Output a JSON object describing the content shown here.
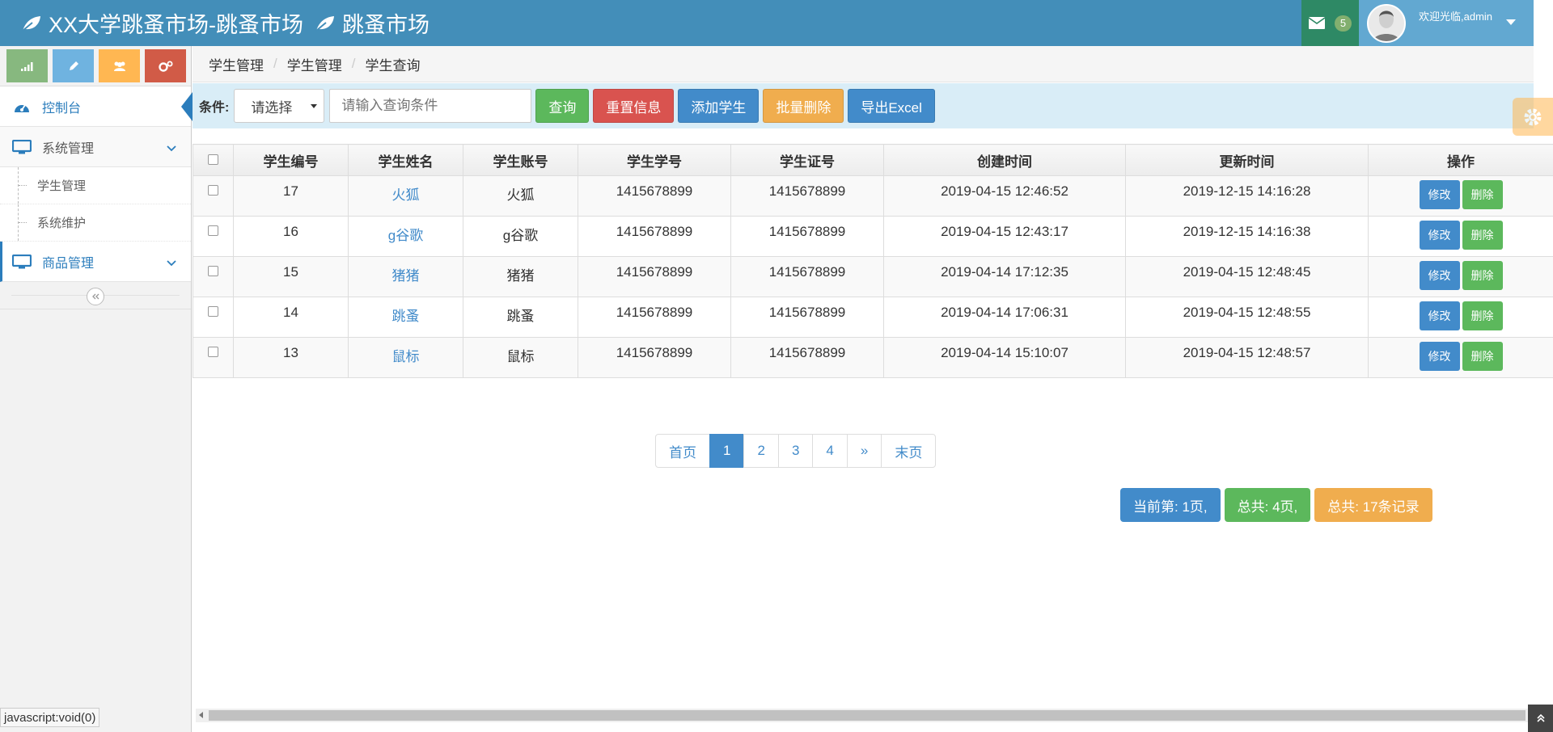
{
  "navbar": {
    "brand_primary": "XX大学跳蚤市场-跳蚤市场",
    "brand_secondary": "跳蚤市场",
    "mail_count": "5",
    "welcome": "欢迎光临,admin"
  },
  "sidebar": {
    "items": [
      {
        "label": "控制台"
      },
      {
        "label": "系统管理"
      },
      {
        "label": "商品管理"
      }
    ],
    "sub_items": [
      {
        "label": "学生管理"
      },
      {
        "label": "系统维护"
      }
    ]
  },
  "breadcrumb": {
    "items": [
      {
        "label": "学生管理"
      },
      {
        "label": "学生管理"
      },
      {
        "label": "学生查询"
      }
    ]
  },
  "search": {
    "label": "条件:",
    "select_value": "请选择",
    "placeholder": "请输入查询条件",
    "buttons": {
      "query": "查询",
      "reset": "重置信息",
      "add": "添加学生",
      "batch_delete": "批量删除",
      "export": "导出Excel"
    }
  },
  "table": {
    "headers": [
      "学生编号",
      "学生姓名",
      "学生账号",
      "学生学号",
      "学生证号",
      "创建时间",
      "更新时间",
      "操作"
    ],
    "edit_label": "修改",
    "delete_label": "删除",
    "rows": [
      [
        "17",
        "火狐",
        "火狐",
        "1415678899",
        "1415678899",
        "2019-04-15 12:46:52",
        "2019-12-15 14:16:28"
      ],
      [
        "16",
        "g谷歌",
        "g谷歌",
        "1415678899",
        "1415678899",
        "2019-04-15 12:43:17",
        "2019-12-15 14:16:38"
      ],
      [
        "15",
        "猪猪",
        "猪猪",
        "1415678899",
        "1415678899",
        "2019-04-14 17:12:35",
        "2019-04-15 12:48:45"
      ],
      [
        "14",
        "跳蚤",
        "跳蚤",
        "1415678899",
        "1415678899",
        "2019-04-14 17:06:31",
        "2019-04-15 12:48:55"
      ],
      [
        "13",
        "鼠标",
        "鼠标",
        "1415678899",
        "1415678899",
        "2019-04-14 15:10:07",
        "2019-04-15 12:48:57"
      ]
    ]
  },
  "pagination": {
    "first": "首页",
    "pages": [
      "1",
      "2",
      "3",
      "4"
    ],
    "next": "»",
    "last": "末页",
    "current_info": "当前第: 1页,",
    "total_pages": "总共: 4页,",
    "total_records": "总共: 17条记录"
  },
  "status_url": "javascript:void(0)",
  "colors": {
    "navbar": "#438eb9",
    "primary": "#428bca",
    "success": "#5cb85c",
    "danger": "#d9534f",
    "warning": "#f0ad4e"
  }
}
